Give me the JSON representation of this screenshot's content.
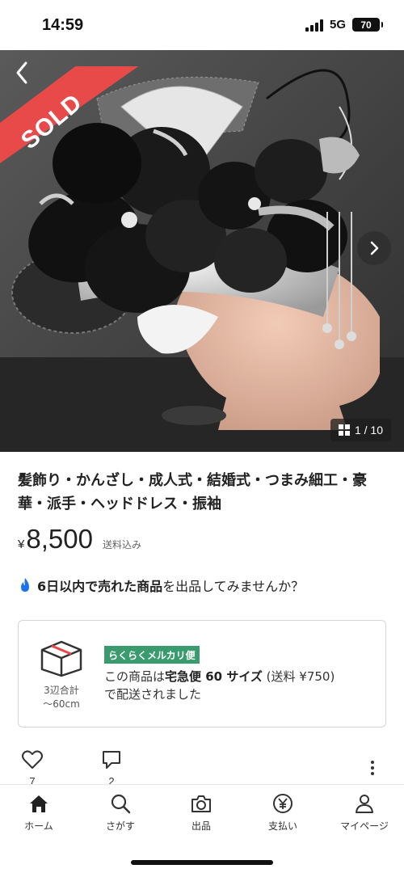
{
  "status": {
    "time": "14:59",
    "network": "5G",
    "battery": "70"
  },
  "hero": {
    "sold_label": "SOLD",
    "counter": "1 / 10"
  },
  "item": {
    "title": "髪飾り・かんざし・成人式・結婚式・つまみ細工・豪華・派手・ヘッドドレス・振袖",
    "currency": "¥",
    "price": "8,500",
    "shipping_included": "送料込み"
  },
  "promo": {
    "bold": "6日以内で売れた商品",
    "rest": "を出品してみませんか？"
  },
  "shipping": {
    "badge": "らくらくメルカリ便",
    "size_line1": "3辺合計",
    "size_line2": "〜60cm",
    "text_pre": "この商品は",
    "text_bold": "宅急便 60 サイズ",
    "text_post": " (送料 ¥750)",
    "text_line2": "で配送されました"
  },
  "actions": {
    "likes": "7",
    "comments": "2"
  },
  "tabs": [
    {
      "label": "ホーム",
      "icon": "home-icon"
    },
    {
      "label": "さがす",
      "icon": "search-icon"
    },
    {
      "label": "出品",
      "icon": "camera-icon"
    },
    {
      "label": "支払い",
      "icon": "yen-coin-icon"
    },
    {
      "label": "マイページ",
      "icon": "person-icon"
    }
  ],
  "colors": {
    "sold_red": "#e84a4a",
    "rakuraku_green": "#3a9b6e",
    "accent_blue": "#1a73e8"
  }
}
